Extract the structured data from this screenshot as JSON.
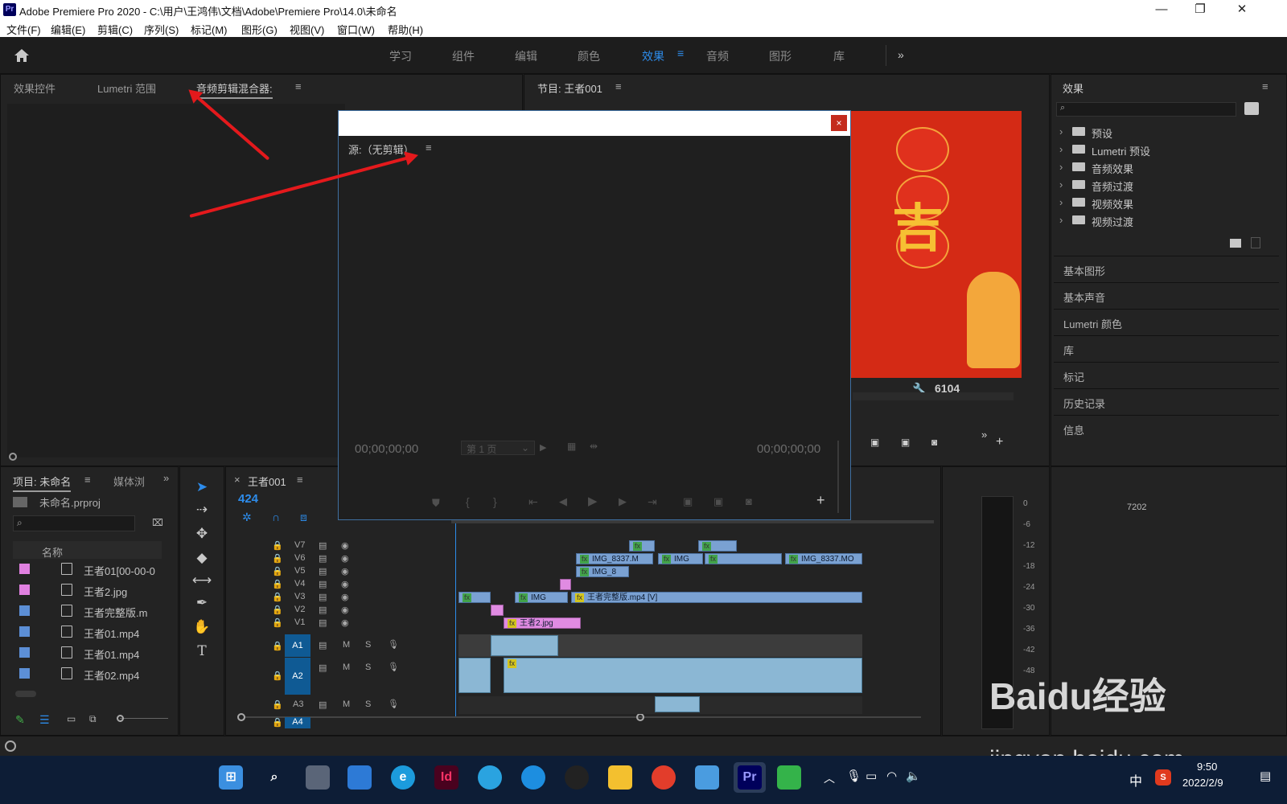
{
  "titlebar": {
    "app_icon": "Pr",
    "title": "Adobe Premiere Pro 2020 - C:\\用户\\王鸿伟\\文档\\Adobe\\Premiere Pro\\14.0\\未命名",
    "minimize": "—",
    "restore": "❐",
    "close": "✕"
  },
  "menubar": {
    "items": [
      "文件(F)",
      "编辑(E)",
      "剪辑(C)",
      "序列(S)",
      "标记(M)",
      "图形(G)",
      "视图(V)",
      "窗口(W)",
      "帮助(H)"
    ]
  },
  "workspaces": {
    "items": [
      "学习",
      "组件",
      "编辑",
      "颜色",
      "效果",
      "音频",
      "图形",
      "库"
    ],
    "active": "效果",
    "more": "»"
  },
  "left_panel": {
    "tabs": [
      "效果控件",
      "Lumetri 范围",
      "音频剪辑混合器:"
    ],
    "menu": "≡"
  },
  "program_monitor": {
    "tab": "节目: 王者001",
    "menu": "≡",
    "frame_readout": "6104",
    "image_text": "吉"
  },
  "effects_panel": {
    "title": "效果",
    "menu": "≡",
    "search_placeholder": "",
    "folders": [
      "预设",
      "Lumetri 预设",
      "音频效果",
      "音频过渡",
      "视频效果",
      "视频过渡"
    ],
    "sections": [
      "基本图形",
      "基本声音",
      "Lumetri 颜色",
      "库",
      "标记",
      "历史记录",
      "信息"
    ]
  },
  "project_panel": {
    "tab": "项目: 未命名",
    "tab2": "媒体浏",
    "menu": "≡",
    "more": "»",
    "file": "未命名.prproj",
    "column": "名称",
    "items": [
      {
        "name": "王者01[00-00-0",
        "color": "#e080e0"
      },
      {
        "name": "王者2.jpg",
        "color": "#e080e0"
      },
      {
        "name": "王者完整版.m",
        "color": "#5c8fd6"
      },
      {
        "name": "王者01.mp4",
        "color": "#5c8fd6"
      },
      {
        "name": "王者01.mp4",
        "color": "#5c8fd6"
      },
      {
        "name": "王者02.mp4",
        "color": "#5c8fd6"
      }
    ]
  },
  "timeline": {
    "tab": "王者001",
    "close": "×",
    "menu": "≡",
    "timecode": "424",
    "ruler_label": "7202",
    "video_tracks": [
      "V7",
      "V6",
      "V5",
      "V4",
      "V3",
      "V2",
      "V1"
    ],
    "audio_tracks": [
      "A1",
      "A2",
      "A3",
      "A4"
    ],
    "track_m": "M",
    "track_s": "S",
    "clips": {
      "v6a": "IMG_8337.M",
      "v6b": "IMG",
      "v6c": "IMG_8337.MO",
      "v5": "IMG_8",
      "v3a": "IMG",
      "v3b": "王者完整版.mp4 [V]",
      "v1": "王者2.jpg",
      "fx": "fx"
    }
  },
  "meter": {
    "labels": [
      "0",
      "-6",
      "-12",
      "-18",
      "-24",
      "-30",
      "-36",
      "-42",
      "-48"
    ]
  },
  "dialog": {
    "close": "×",
    "source_label": "源:（无剪辑）",
    "menu": "≡",
    "tc_left": "00;00;00;00",
    "page_select": "第 1 页",
    "tc_right": "00;00;00;00",
    "add": "+"
  },
  "taskbar": {
    "ime": "中",
    "time": "9:50",
    "date": "2022/2/9",
    "apps": [
      "windows-start",
      "search",
      "task-view",
      "widgets",
      "edge",
      "indesign",
      "telegram",
      "qq-browser",
      "qq",
      "file-explorer",
      "chrome",
      "notepad",
      "premiere",
      "wechat"
    ],
    "app_labels": {
      "indesign": "Id",
      "premiere": "Pr",
      "edge": "e"
    }
  },
  "watermark": {
    "brand": "Baidu经验",
    "url": "jingyan.baidu.com"
  },
  "colors": {
    "accent": "#2d8ceb",
    "video_clip": "#7aa1d2",
    "image_clip": "#e08be2",
    "audio_clip": "#8bb7d4",
    "annotation": "#e4191c",
    "taskbar": "#0d1d36"
  }
}
